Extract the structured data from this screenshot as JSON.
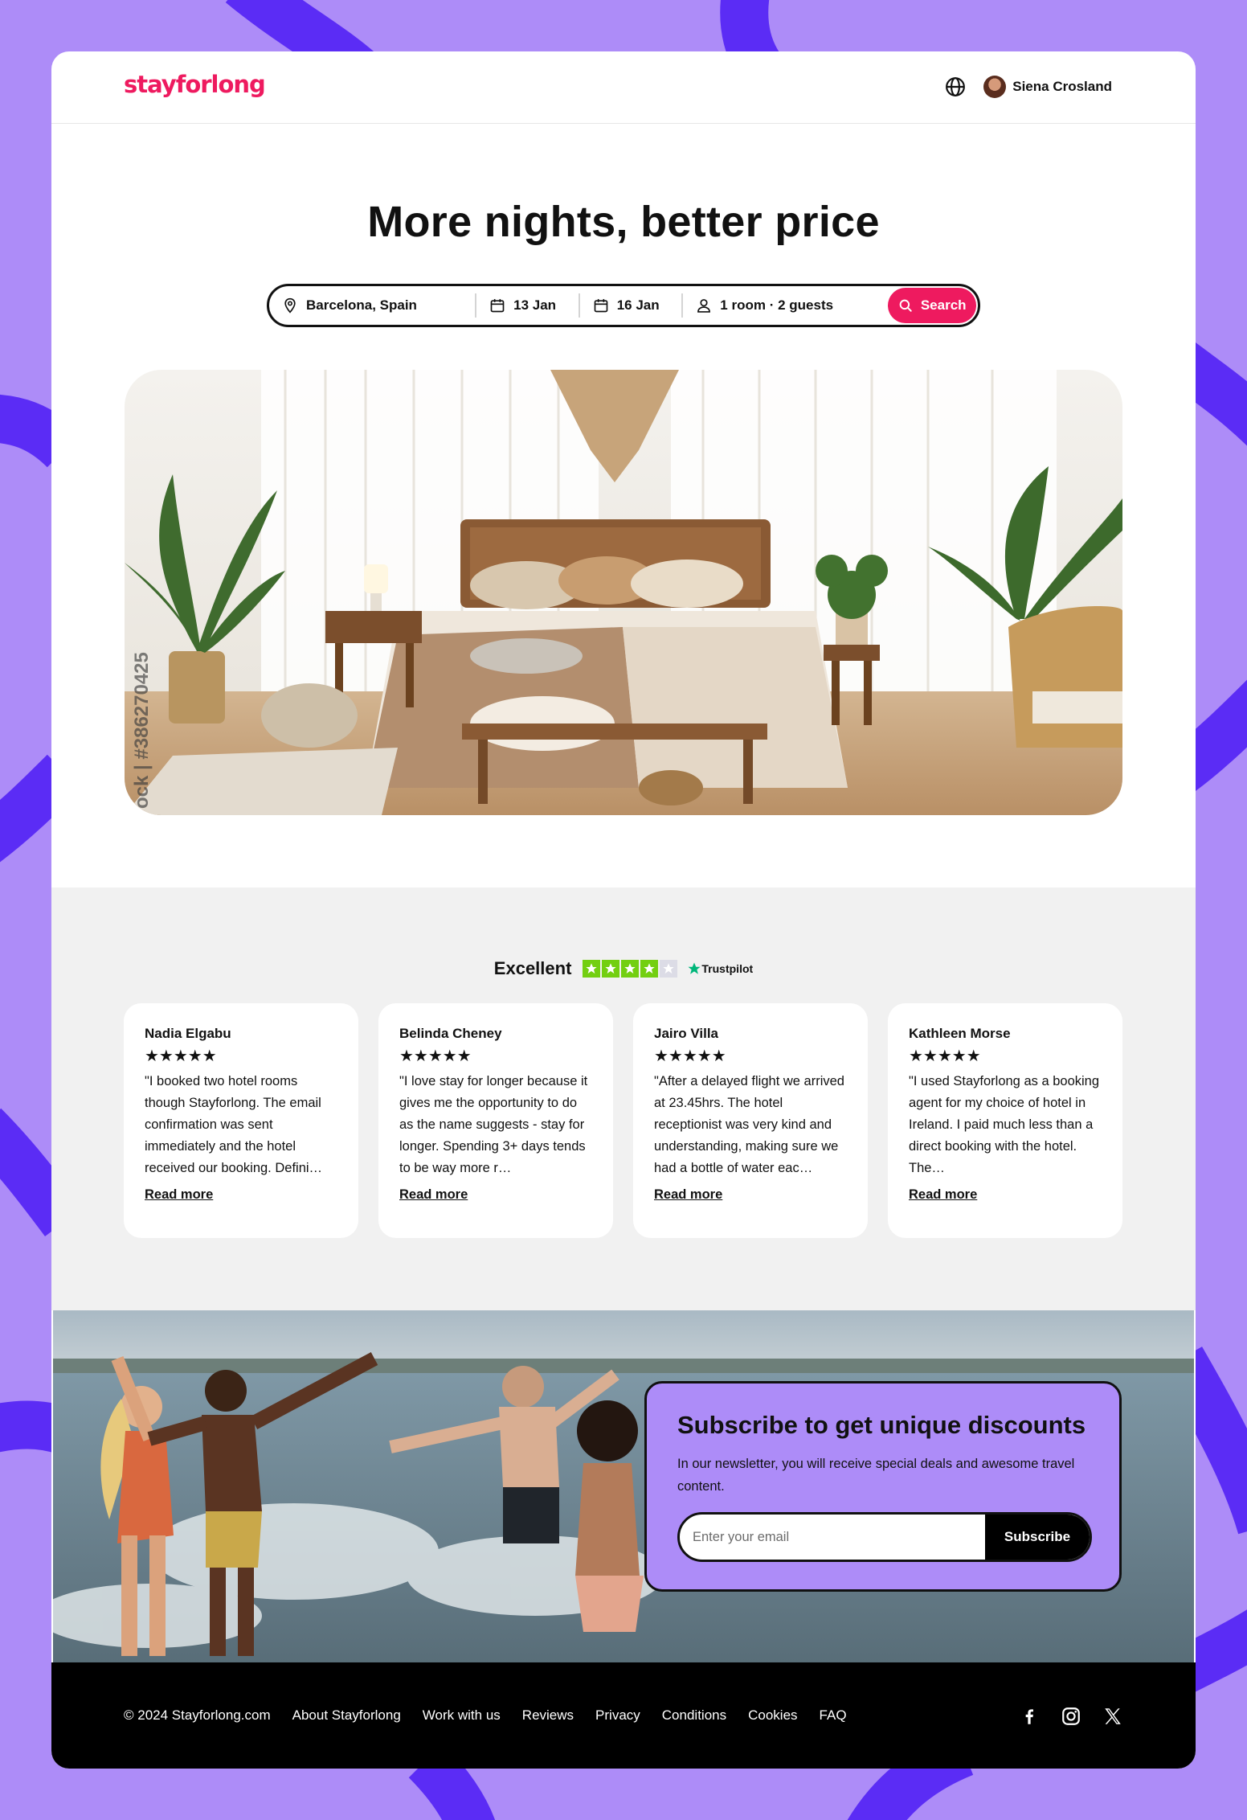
{
  "brand": {
    "logo_text": "stayforlong",
    "accent_color": "#ee1a5f",
    "background_color": "#ad8cf8"
  },
  "header": {
    "language_icon": "globe-icon",
    "user": {
      "name": "Siena Crosland",
      "avatar_icon": "avatar"
    }
  },
  "hero": {
    "title": "More nights, better price",
    "search": {
      "location": "Barcelona, Spain",
      "check_in": "13 Jan",
      "check_out": "16 Jan",
      "guests": "1 room · 2 guests",
      "button_label": "Search"
    },
    "image_watermark": "ock | #386270425"
  },
  "reviews": {
    "rating_label": "Excellent",
    "trustpilot_stars": 4,
    "trustpilot_brand": "Trustpilot",
    "items": [
      {
        "name": "Nadia Elgabu",
        "stars": "★★★★★",
        "text": "\"I booked two hotel rooms though Stayforlong. The email confirmation was sent immediately and the hotel received our booking. Defini…",
        "link": "Read more"
      },
      {
        "name": "Belinda Cheney",
        "stars": "★★★★★",
        "text": "\"I love stay for longer because it gives me the opportunity to do as the name suggests - stay for longer. Spending 3+ days tends to be way more r…",
        "link": "Read more"
      },
      {
        "name": "Jairo Villa",
        "stars": "★★★★★",
        "text": "\"After a delayed flight we arrived at 23.45hrs. The hotel receptionist was very kind and understanding, making sure we had a bottle of water eac…",
        "link": "Read more"
      },
      {
        "name": "Kathleen Morse",
        "stars": "★★★★★",
        "text": "\"I used Stayforlong as a booking agent for my choice of hotel in Ireland. I paid much less than a direct booking with the hotel. The…",
        "link": "Read more"
      }
    ]
  },
  "subscribe": {
    "title": "Subscribe to get unique discounts",
    "description": "In our newsletter, you will receive special deals and awesome travel content.",
    "email_placeholder": "Enter your email",
    "button_label": "Subscribe"
  },
  "footer": {
    "copyright": "© 2024 Stayforlong.com",
    "links": [
      "About Stayforlong",
      "Work with us",
      "Reviews",
      "Privacy",
      "Conditions",
      "Cookies",
      "FAQ"
    ],
    "social_icons": [
      "facebook-icon",
      "instagram-icon",
      "x-icon"
    ]
  }
}
